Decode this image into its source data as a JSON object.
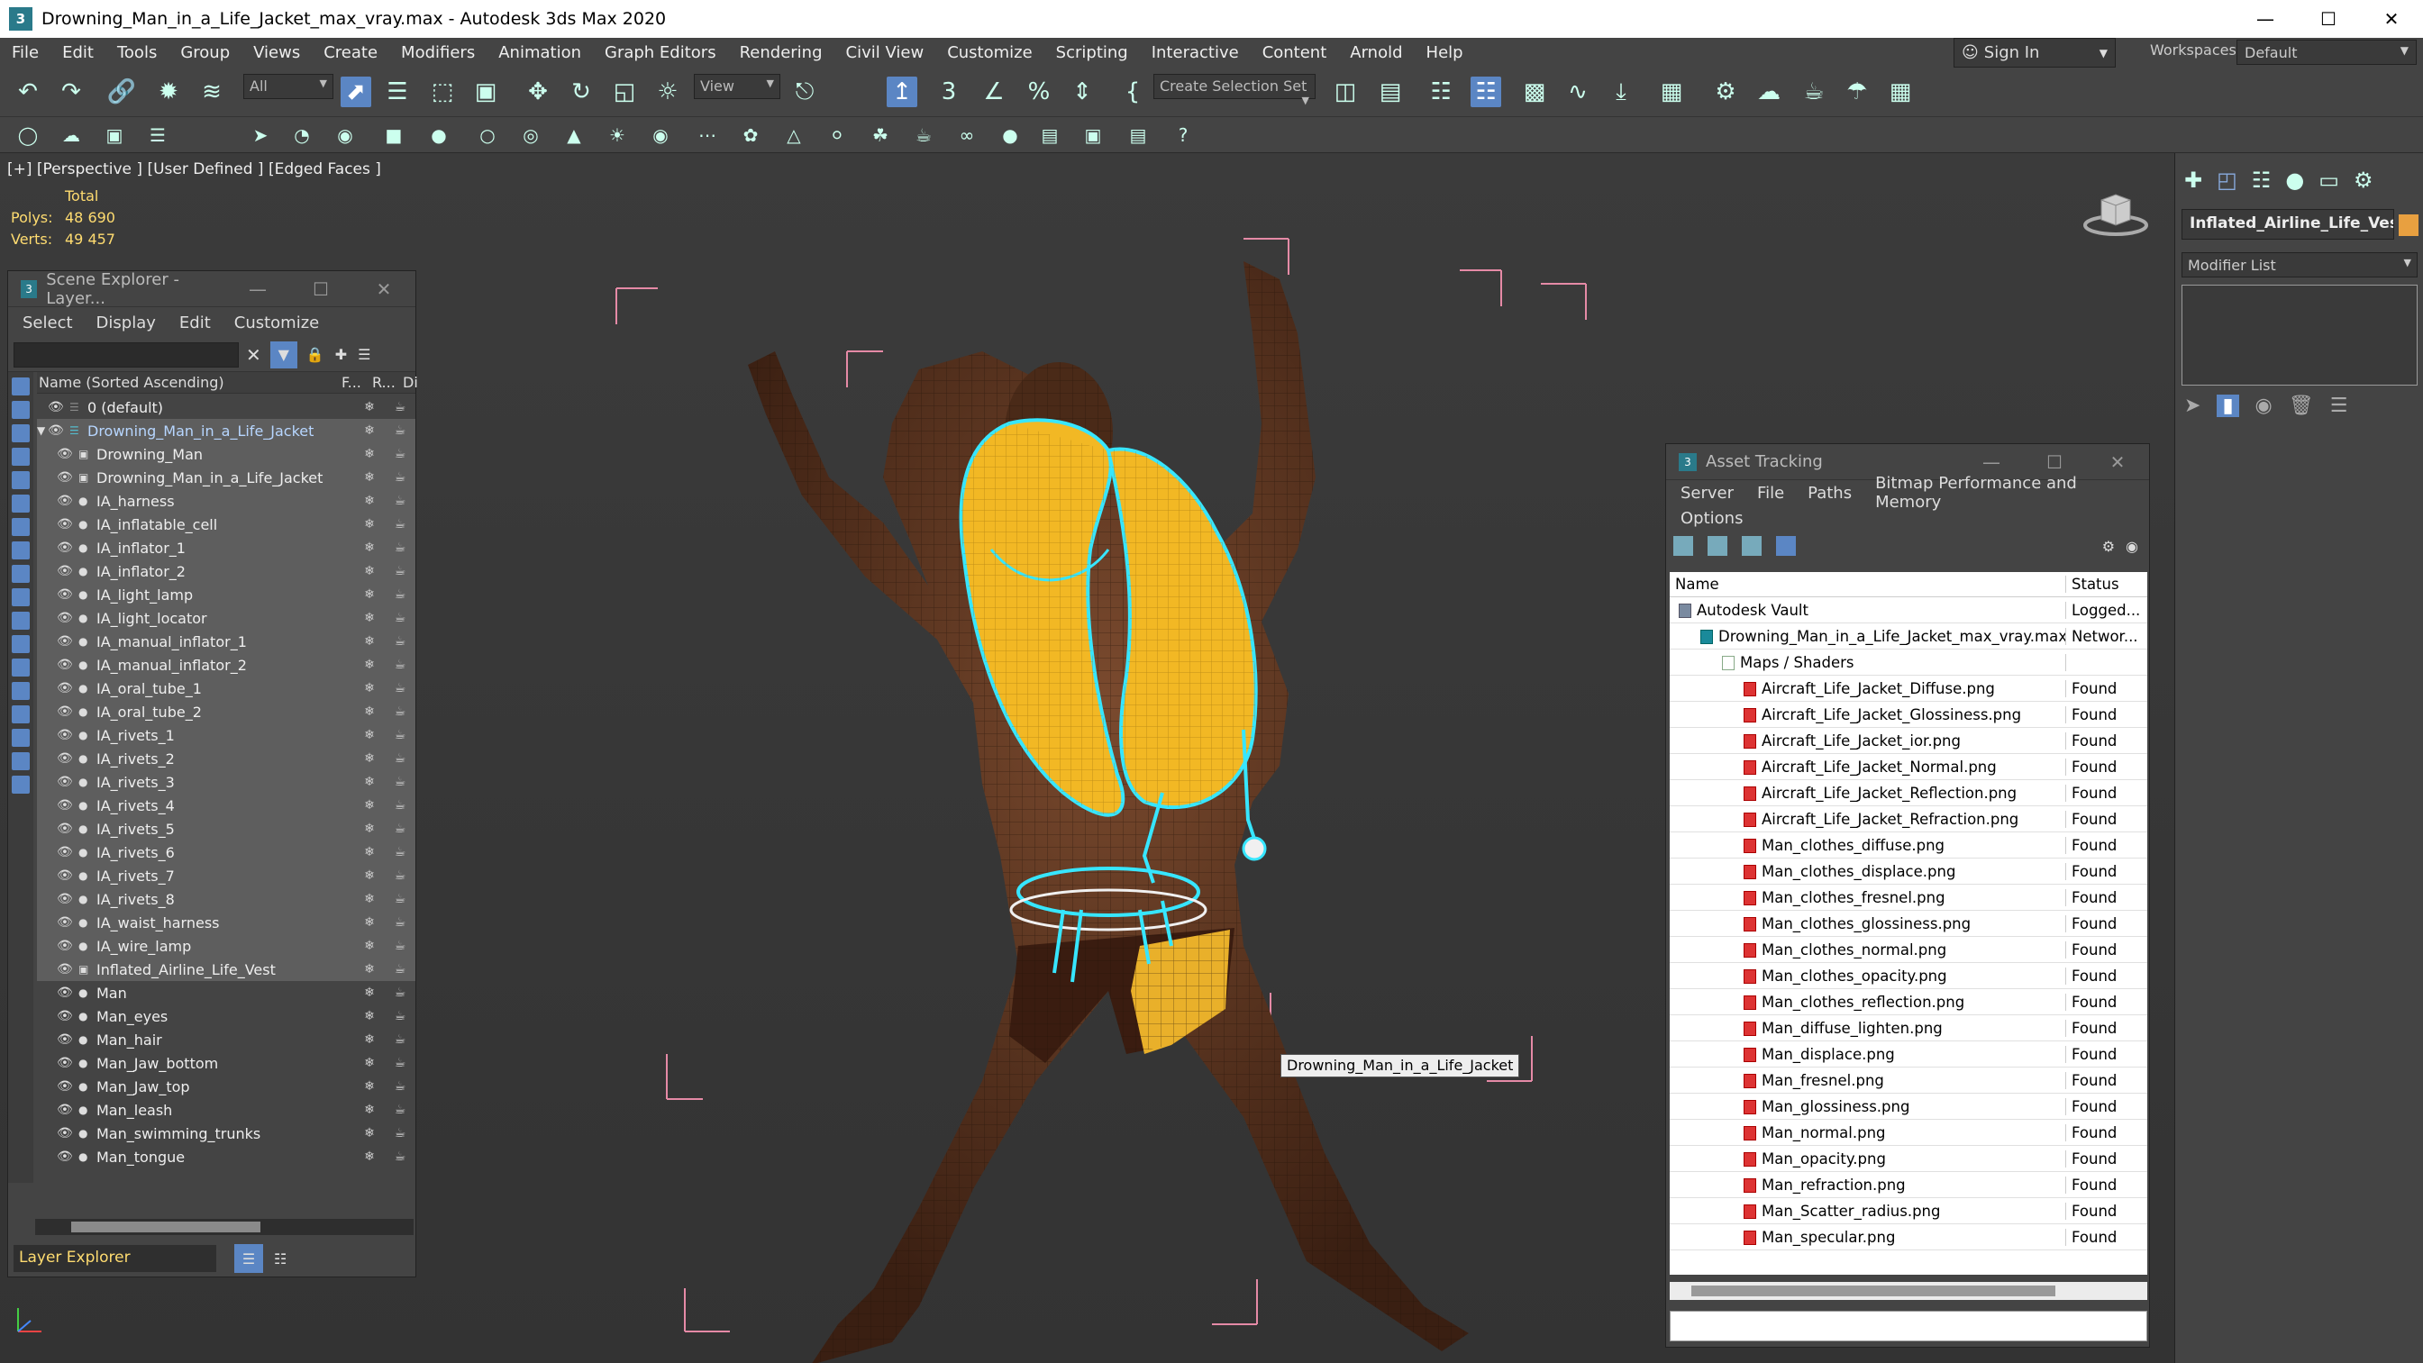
{
  "window": {
    "title": "Drowning_Man_in_a_Life_Jacket_max_vray.max - Autodesk 3ds Max 2020",
    "app_icon": "3"
  },
  "menubar": [
    "File",
    "Edit",
    "Tools",
    "Group",
    "Views",
    "Create",
    "Modifiers",
    "Animation",
    "Graph Editors",
    "Rendering",
    "Civil View",
    "Customize",
    "Scripting",
    "Interactive",
    "Content",
    "Arnold",
    "Help"
  ],
  "account": {
    "sign_in": "Sign In",
    "workspaces_label": "Workspaces:",
    "workspace": "Default"
  },
  "toolbar": {
    "selection_filter": "All",
    "ref_coord": "View",
    "selection_set": "Create Selection Set"
  },
  "viewport": {
    "label": "[+] [Perspective ] [User Defined ] [Edged Faces ]",
    "stats": {
      "header": "Total",
      "polys_label": "Polys:",
      "polys": "48 690",
      "verts_label": "Verts:",
      "verts": "49 457"
    },
    "tooltip": "Drowning_Man_in_a_Life_Jacket"
  },
  "scene_explorer": {
    "title": "Scene Explorer - Layer...",
    "menu": [
      "Select",
      "Display",
      "Edit",
      "Customize"
    ],
    "columns": {
      "name": "Name (Sorted Ascending)",
      "f": "F...",
      "r": "R...",
      "d": "Di"
    },
    "rows": [
      {
        "name": "0 (default)",
        "indent": 0,
        "kind": "layer"
      },
      {
        "name": "Drowning_Man_in_a_Life_Jacket",
        "indent": 0,
        "kind": "layer",
        "selected": true,
        "blue": true
      },
      {
        "name": "Drowning_Man",
        "indent": 1,
        "kind": "group",
        "selected": true
      },
      {
        "name": "Drowning_Man_in_a_Life_Jacket",
        "indent": 1,
        "kind": "group",
        "selected": true
      },
      {
        "name": "IA_harness",
        "indent": 1,
        "kind": "obj",
        "selected": true
      },
      {
        "name": "IA_inflatable_cell",
        "indent": 1,
        "kind": "obj",
        "selected": true
      },
      {
        "name": "IA_inflator_1",
        "indent": 1,
        "kind": "obj",
        "selected": true
      },
      {
        "name": "IA_inflator_2",
        "indent": 1,
        "kind": "obj",
        "selected": true
      },
      {
        "name": "IA_light_lamp",
        "indent": 1,
        "kind": "obj",
        "selected": true
      },
      {
        "name": "IA_light_locator",
        "indent": 1,
        "kind": "obj",
        "selected": true
      },
      {
        "name": "IA_manual_inflator_1",
        "indent": 1,
        "kind": "obj",
        "selected": true
      },
      {
        "name": "IA_manual_inflator_2",
        "indent": 1,
        "kind": "obj",
        "selected": true
      },
      {
        "name": "IA_oral_tube_1",
        "indent": 1,
        "kind": "obj",
        "selected": true
      },
      {
        "name": "IA_oral_tube_2",
        "indent": 1,
        "kind": "obj",
        "selected": true
      },
      {
        "name": "IA_rivets_1",
        "indent": 1,
        "kind": "obj",
        "selected": true
      },
      {
        "name": "IA_rivets_2",
        "indent": 1,
        "kind": "obj",
        "selected": true
      },
      {
        "name": "IA_rivets_3",
        "indent": 1,
        "kind": "obj",
        "selected": true
      },
      {
        "name": "IA_rivets_4",
        "indent": 1,
        "kind": "obj",
        "selected": true
      },
      {
        "name": "IA_rivets_5",
        "indent": 1,
        "kind": "obj",
        "selected": true
      },
      {
        "name": "IA_rivets_6",
        "indent": 1,
        "kind": "obj",
        "selected": true
      },
      {
        "name": "IA_rivets_7",
        "indent": 1,
        "kind": "obj",
        "selected": true
      },
      {
        "name": "IA_rivets_8",
        "indent": 1,
        "kind": "obj",
        "selected": true
      },
      {
        "name": "IA_waist_harness",
        "indent": 1,
        "kind": "obj",
        "selected": true
      },
      {
        "name": "IA_wire_lamp",
        "indent": 1,
        "kind": "obj",
        "selected": true
      },
      {
        "name": "Inflated_Airline_Life_Vest",
        "indent": 1,
        "kind": "group",
        "selected": true
      },
      {
        "name": "Man",
        "indent": 1,
        "kind": "obj"
      },
      {
        "name": "Man_eyes",
        "indent": 1,
        "kind": "obj"
      },
      {
        "name": "Man_hair",
        "indent": 1,
        "kind": "obj"
      },
      {
        "name": "Man_Jaw_bottom",
        "indent": 1,
        "kind": "obj"
      },
      {
        "name": "Man_Jaw_top",
        "indent": 1,
        "kind": "obj"
      },
      {
        "name": "Man_leash",
        "indent": 1,
        "kind": "obj"
      },
      {
        "name": "Man_swimming_trunks",
        "indent": 1,
        "kind": "obj"
      },
      {
        "name": "Man_tongue",
        "indent": 1,
        "kind": "obj"
      }
    ],
    "footer": "Layer Explorer"
  },
  "asset_tracking": {
    "title": "Asset Tracking",
    "menu": [
      "Server",
      "File",
      "Paths",
      "Bitmap Performance and Memory"
    ],
    "menu2": "Options",
    "columns": {
      "name": "Name",
      "status": "Status"
    },
    "rows": [
      {
        "name": "Autodesk Vault",
        "status": "Logged...",
        "indent": 0,
        "icon": "v"
      },
      {
        "name": "Drowning_Man_in_a_Life_Jacket_max_vray.max",
        "status": "Networ...",
        "indent": 1,
        "icon": "m"
      },
      {
        "name": "Maps / Shaders",
        "status": "",
        "indent": 2,
        "icon": "f"
      },
      {
        "name": "Aircraft_Life_Jacket_Diffuse.png",
        "status": "Found",
        "indent": 3,
        "icon": "p"
      },
      {
        "name": "Aircraft_Life_Jacket_Glossiness.png",
        "status": "Found",
        "indent": 3,
        "icon": "p"
      },
      {
        "name": "Aircraft_Life_Jacket_ior.png",
        "status": "Found",
        "indent": 3,
        "icon": "p"
      },
      {
        "name": "Aircraft_Life_Jacket_Normal.png",
        "status": "Found",
        "indent": 3,
        "icon": "p"
      },
      {
        "name": "Aircraft_Life_Jacket_Reflection.png",
        "status": "Found",
        "indent": 3,
        "icon": "p"
      },
      {
        "name": "Aircraft_Life_Jacket_Refraction.png",
        "status": "Found",
        "indent": 3,
        "icon": "p"
      },
      {
        "name": "Man_clothes_diffuse.png",
        "status": "Found",
        "indent": 3,
        "icon": "p"
      },
      {
        "name": "Man_clothes_displace.png",
        "status": "Found",
        "indent": 3,
        "icon": "p"
      },
      {
        "name": "Man_clothes_fresnel.png",
        "status": "Found",
        "indent": 3,
        "icon": "p"
      },
      {
        "name": "Man_clothes_glossiness.png",
        "status": "Found",
        "indent": 3,
        "icon": "p"
      },
      {
        "name": "Man_clothes_normal.png",
        "status": "Found",
        "indent": 3,
        "icon": "p"
      },
      {
        "name": "Man_clothes_opacity.png",
        "status": "Found",
        "indent": 3,
        "icon": "p"
      },
      {
        "name": "Man_clothes_reflection.png",
        "status": "Found",
        "indent": 3,
        "icon": "p"
      },
      {
        "name": "Man_diffuse_lighten.png",
        "status": "Found",
        "indent": 3,
        "icon": "p"
      },
      {
        "name": "Man_displace.png",
        "status": "Found",
        "indent": 3,
        "icon": "p"
      },
      {
        "name": "Man_fresnel.png",
        "status": "Found",
        "indent": 3,
        "icon": "p"
      },
      {
        "name": "Man_glossiness.png",
        "status": "Found",
        "indent": 3,
        "icon": "p"
      },
      {
        "name": "Man_normal.png",
        "status": "Found",
        "indent": 3,
        "icon": "p"
      },
      {
        "name": "Man_opacity.png",
        "status": "Found",
        "indent": 3,
        "icon": "p"
      },
      {
        "name": "Man_refraction.png",
        "status": "Found",
        "indent": 3,
        "icon": "p"
      },
      {
        "name": "Man_Scatter_radius.png",
        "status": "Found",
        "indent": 3,
        "icon": "p"
      },
      {
        "name": "Man_specular.png",
        "status": "Found",
        "indent": 3,
        "icon": "p"
      }
    ]
  },
  "command_panel": {
    "object_name": "Inflated_Airline_Life_Vest",
    "modifier_list": "Modifier List"
  },
  "colors": {
    "selection_cyan": "#37e6ff",
    "stats_yellow": "#ffdc70",
    "bbox_pink": "#e58aa6",
    "vest_yellow": "#f2b824",
    "skin": "#5a3320"
  }
}
